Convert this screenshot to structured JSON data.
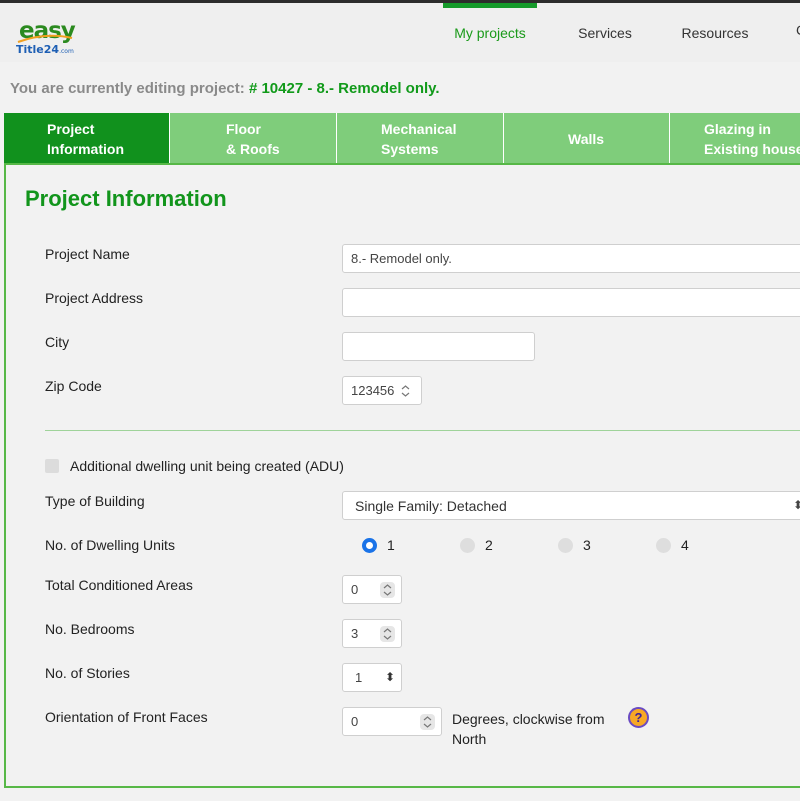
{
  "nav": {
    "items": [
      {
        "label": "My projects",
        "active": true
      },
      {
        "label": "Services",
        "active": false
      },
      {
        "label": "Resources",
        "active": false
      }
    ],
    "partial_item": "C"
  },
  "logo": {
    "line1": "easy",
    "line2": "Title24",
    "line2_suffix": ".com"
  },
  "editing": {
    "prefix": "You are currently editing project: ",
    "project": "# 10427 - 8.- Remodel only."
  },
  "tabs": [
    {
      "label": "Project\nInformation",
      "active": true
    },
    {
      "label": "Floor\n& Roofs",
      "active": false
    },
    {
      "label": "Mechanical\nSystems",
      "active": false
    },
    {
      "label": "Walls",
      "active": false
    },
    {
      "label": "Glazing in\nExisting house",
      "active": false
    }
  ],
  "page_title": "Project Information",
  "form": {
    "project_name": {
      "label": "Project Name",
      "value": "8.- Remodel only."
    },
    "project_address": {
      "label": "Project Address",
      "value": ""
    },
    "city": {
      "label": "City",
      "value": ""
    },
    "zip_code": {
      "label": "Zip Code",
      "value": "123456"
    },
    "adu": {
      "label": "Additional dwelling unit being created (ADU)",
      "checked": false
    },
    "type_of_building": {
      "label": "Type of Building",
      "value": "Single Family: Detached"
    },
    "dwelling_units": {
      "label": "No. of Dwelling Units",
      "options": [
        "1",
        "2",
        "3",
        "4"
      ],
      "selected": "1"
    },
    "total_conditioned_areas": {
      "label": "Total Conditioned Areas",
      "value": "0"
    },
    "bedrooms": {
      "label": "No. Bedrooms",
      "value": "3"
    },
    "stories": {
      "label": "No. of Stories",
      "value": "1"
    },
    "orientation": {
      "label": "Orientation of Front Faces",
      "value": "0",
      "unit": "Degrees, clockwise from North"
    }
  },
  "help_icon": "question-mark-icon",
  "colors": {
    "brand_green": "#11911d",
    "tab_green": "#7fcd7b",
    "title_green": "#12951c",
    "radio_blue": "#1a73e8",
    "help_orange": "#f7a825"
  }
}
